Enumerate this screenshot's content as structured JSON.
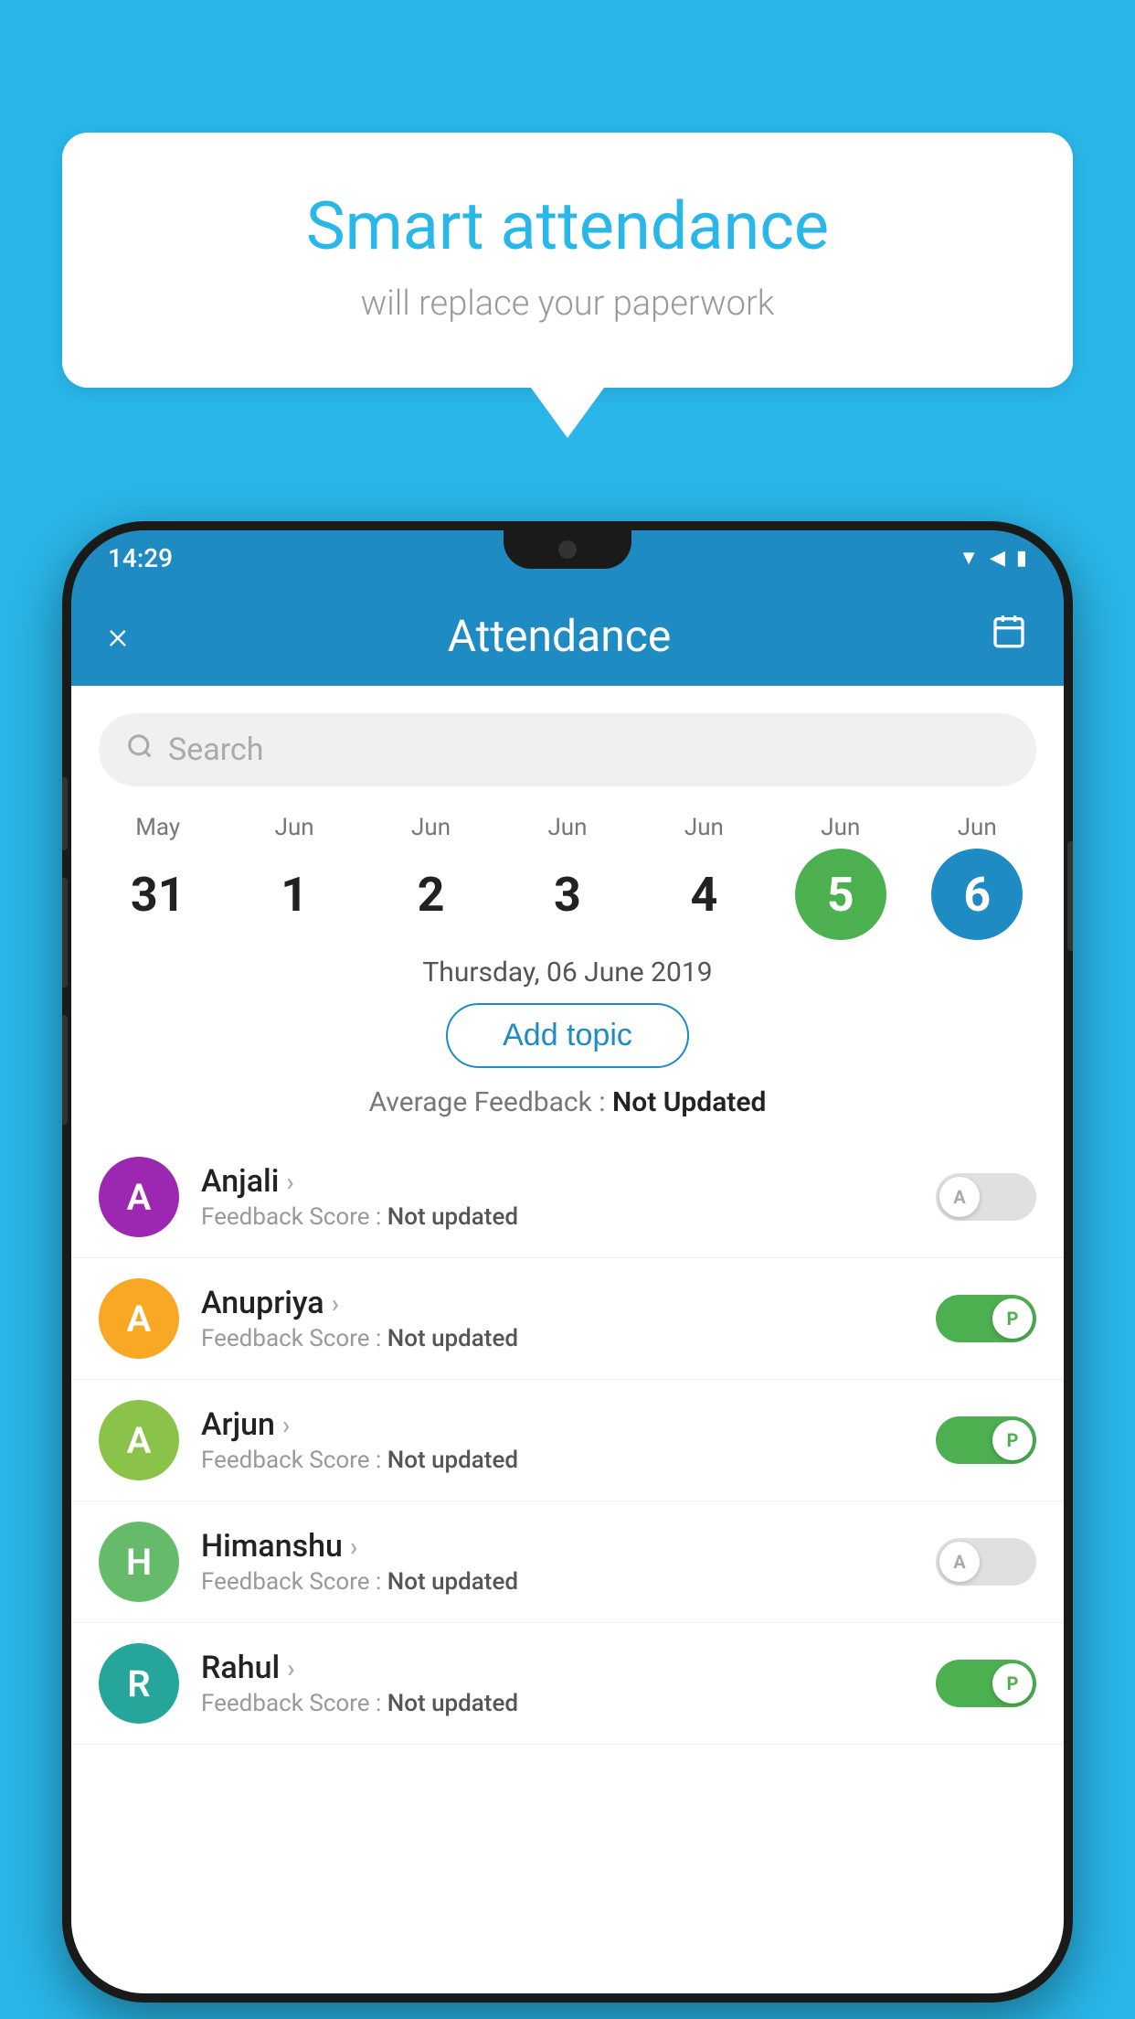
{
  "background_color": "#29b6e8",
  "speech_bubble": {
    "title": "Smart attendance",
    "subtitle": "will replace your paperwork"
  },
  "phone": {
    "status_bar": {
      "time": "14:29",
      "icons": [
        "wifi",
        "signal",
        "battery"
      ]
    },
    "header": {
      "close_label": "×",
      "title": "Attendance",
      "calendar_icon": "📅"
    },
    "search": {
      "placeholder": "Search"
    },
    "dates": [
      {
        "month": "May",
        "day": "31",
        "state": "normal"
      },
      {
        "month": "Jun",
        "day": "1",
        "state": "normal"
      },
      {
        "month": "Jun",
        "day": "2",
        "state": "normal"
      },
      {
        "month": "Jun",
        "day": "3",
        "state": "normal"
      },
      {
        "month": "Jun",
        "day": "4",
        "state": "normal"
      },
      {
        "month": "Jun",
        "day": "5",
        "state": "today"
      },
      {
        "month": "Jun",
        "day": "6",
        "state": "selected"
      }
    ],
    "selected_date_label": "Thursday, 06 June 2019",
    "add_topic_label": "Add topic",
    "feedback_label": "Average Feedback : ",
    "feedback_value": "Not Updated",
    "students": [
      {
        "name": "Anjali",
        "avatar_letter": "A",
        "avatar_color": "purple",
        "feedback_label": "Feedback Score : ",
        "feedback_value": "Not updated",
        "toggle_state": "off",
        "toggle_label": "A"
      },
      {
        "name": "Anupriya",
        "avatar_letter": "A",
        "avatar_color": "yellow",
        "feedback_label": "Feedback Score : ",
        "feedback_value": "Not updated",
        "toggle_state": "on",
        "toggle_label": "P"
      },
      {
        "name": "Arjun",
        "avatar_letter": "A",
        "avatar_color": "light-green",
        "feedback_label": "Feedback Score : ",
        "feedback_value": "Not updated",
        "toggle_state": "on",
        "toggle_label": "P"
      },
      {
        "name": "Himanshu",
        "avatar_letter": "H",
        "avatar_color": "green-dark",
        "feedback_label": "Feedback Score : ",
        "feedback_value": "Not updated",
        "toggle_state": "off",
        "toggle_label": "A"
      },
      {
        "name": "Rahul",
        "avatar_letter": "R",
        "avatar_color": "teal",
        "feedback_label": "Feedback Score : ",
        "feedback_value": "Not updated",
        "toggle_state": "on",
        "toggle_label": "P"
      }
    ]
  }
}
